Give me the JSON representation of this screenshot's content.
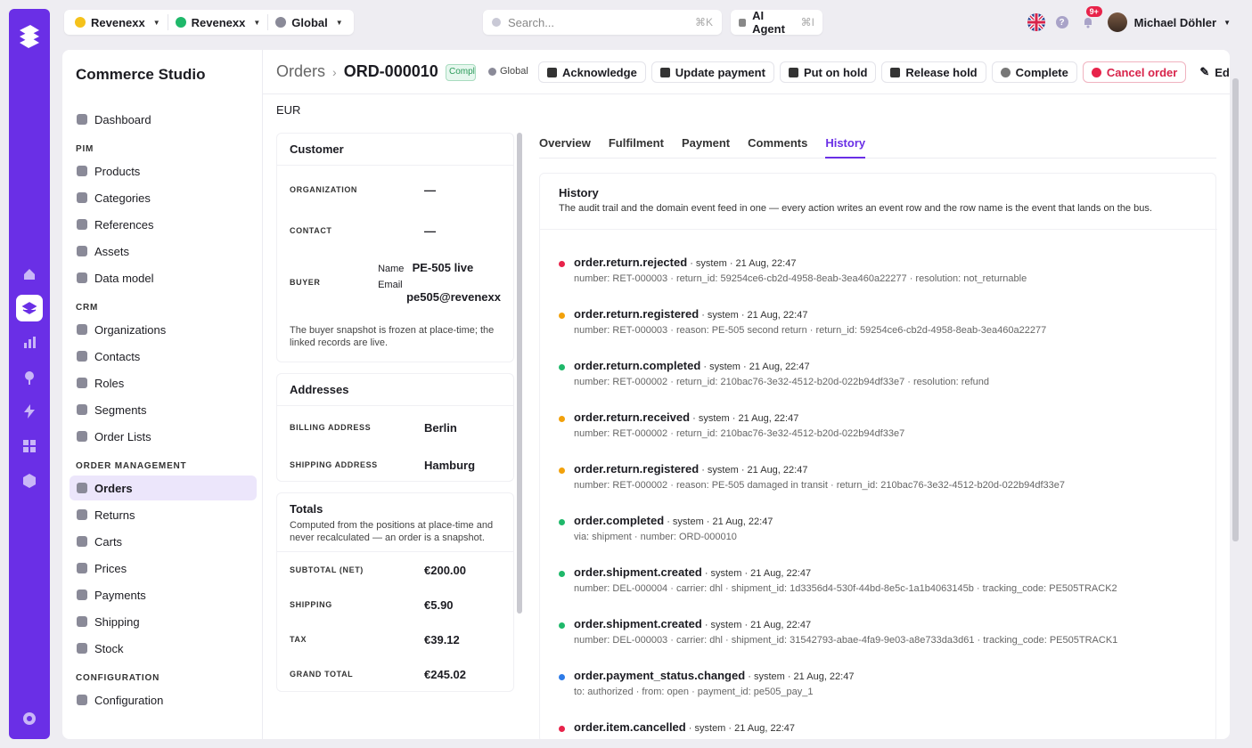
{
  "topbar": {
    "org1": "Revenexx",
    "org2": "Revenexx",
    "scope": "Global",
    "search_placeholder": "Search...",
    "search_kbd": "⌘K",
    "ai_label": "AI Agent",
    "ai_kbd": "⌘I",
    "notif_count": "9+",
    "user_name": "Michael Döhler"
  },
  "sidebar": {
    "app_title": "Commerce Studio",
    "dashboard": "Dashboard",
    "pim_title": "PIM",
    "pim": [
      "Products",
      "Categories",
      "References",
      "Assets",
      "Data model"
    ],
    "crm_title": "CRM",
    "crm": [
      "Organizations",
      "Contacts",
      "Roles",
      "Segments",
      "Order Lists"
    ],
    "om_title": "ORDER MANAGEMENT",
    "om": [
      "Orders",
      "Returns",
      "Carts",
      "Prices",
      "Payments",
      "Shipping",
      "Stock"
    ],
    "cfg_title": "CONFIGURATION",
    "cfg": [
      "Configuration"
    ]
  },
  "header": {
    "crumb_root": "Orders",
    "crumb_id": "ORD-000010",
    "status": "Completed",
    "scope": "Global",
    "actions": [
      "Acknowledge",
      "Update payment",
      "Put on hold",
      "Release hold",
      "Complete",
      "Cancel order",
      "Edit"
    ]
  },
  "currency": "EUR",
  "customer": {
    "title": "Customer",
    "org_label": "ORGANIZATION",
    "org_value": "—",
    "contact_label": "CONTACT",
    "contact_value": "—",
    "buyer_label": "BUYER",
    "name_label": "Name",
    "name_value": "PE-505 live",
    "email_label": "Email",
    "email_value": "pe505@revenexx",
    "note": "The buyer snapshot is frozen at place-time; the linked records are live."
  },
  "addresses": {
    "title": "Addresses",
    "billing_label": "BILLING ADDRESS",
    "billing_value": "Berlin",
    "shipping_label": "SHIPPING ADDRESS",
    "shipping_value": "Hamburg"
  },
  "totals": {
    "title": "Totals",
    "note": "Computed from the positions at place-time and never recalculated — an order is a snapshot.",
    "subtotal_label": "SUBTOTAL (NET)",
    "subtotal": "€200.00",
    "shipping_label": "SHIPPING",
    "shipping": "€5.90",
    "tax_label": "TAX",
    "tax": "€39.12",
    "grand_label": "GRAND TOTAL",
    "grand": "€245.02"
  },
  "tabs": [
    "Overview",
    "Fulfilment",
    "Payment",
    "Comments",
    "History"
  ],
  "history": {
    "title": "History",
    "subtitle": "The audit trail and the domain event feed in one — every action writes an event row and the row name is the event that lands on the bus.",
    "events": [
      {
        "name": "order.return.rejected",
        "meta": " · system · 21 Aug, 22:47",
        "detail": "number: RET-000003 · return_id: 59254ce6-cb2d-4958-8eab-3ea460a22277 · resolution: not_returnable",
        "color": "#e8234a"
      },
      {
        "name": "order.return.registered",
        "meta": " · system · 21 Aug, 22:47",
        "detail": "number: RET-000003 · reason: PE-505 second return · return_id: 59254ce6-cb2d-4958-8eab-3ea460a22277",
        "color": "#f2a10b"
      },
      {
        "name": "order.return.completed",
        "meta": " · system · 21 Aug, 22:47",
        "detail": "number: RET-000002 · return_id: 210bac76-3e32-4512-b20d-022b94df33e7 · resolution: refund",
        "color": "#1fb86a"
      },
      {
        "name": "order.return.received",
        "meta": " · system · 21 Aug, 22:47",
        "detail": "number: RET-000002 · return_id: 210bac76-3e32-4512-b20d-022b94df33e7",
        "color": "#f2a10b"
      },
      {
        "name": "order.return.registered",
        "meta": " · system · 21 Aug, 22:47",
        "detail": "number: RET-000002 · reason: PE-505 damaged in transit · return_id: 210bac76-3e32-4512-b20d-022b94df33e7",
        "color": "#f2a10b"
      },
      {
        "name": "order.completed",
        "meta": " · system · 21 Aug, 22:47",
        "detail": "via: shipment · number: ORD-000010",
        "color": "#1fb86a"
      },
      {
        "name": "order.shipment.created",
        "meta": " · system · 21 Aug, 22:47",
        "detail": "number: DEL-000004 · carrier: dhl · shipment_id: 1d3356d4-530f-44bd-8e5c-1a1b4063145b · tracking_code: PE505TRACK2",
        "color": "#1fb86a"
      },
      {
        "name": "order.shipment.created",
        "meta": " · system · 21 Aug, 22:47",
        "detail": "number: DEL-000003 · carrier: dhl · shipment_id: 31542793-abae-4fa9-9e03-a8e733da3d61 · tracking_code: PE505TRACK1",
        "color": "#1fb86a"
      },
      {
        "name": "order.payment_status.changed",
        "meta": " · system · 21 Aug, 22:47",
        "detail": "to: authorized · from: open · payment_id: pe505_pay_1",
        "color": "#2d7be8"
      },
      {
        "name": "order.item.cancelled",
        "meta": " · system · 21 Aug, 22:47",
        "detail": "",
        "color": "#e8234a"
      }
    ]
  }
}
